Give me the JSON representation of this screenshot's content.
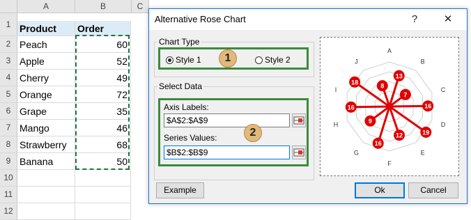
{
  "sheet": {
    "columns": [
      "A",
      "B",
      "C"
    ],
    "rows": [
      "1",
      "2",
      "3",
      "4",
      "5",
      "6",
      "7",
      "8",
      "9",
      "10",
      "11",
      "12"
    ],
    "header": {
      "product": "Product",
      "order": "Order"
    },
    "data": [
      {
        "product": "Peach",
        "order": "60"
      },
      {
        "product": "Apple",
        "order": "52"
      },
      {
        "product": "Cherry",
        "order": "49"
      },
      {
        "product": "Orange",
        "order": "72"
      },
      {
        "product": "Grape",
        "order": "35"
      },
      {
        "product": "Mango",
        "order": "46"
      },
      {
        "product": "Strawberry",
        "order": "68"
      },
      {
        "product": "Banana",
        "order": "50"
      }
    ]
  },
  "dialog": {
    "title": "Alternative Rose Chart",
    "help_label": "?",
    "close_label": "✕",
    "chart_type": {
      "legend": "Chart Type",
      "options": [
        "Style 1",
        "Style 2"
      ],
      "selected": "Style 1",
      "badge": "1"
    },
    "select_data": {
      "legend": "Select Data",
      "axis_label": "Axis Labels:",
      "axis_value": "$A$2:$A$9",
      "series_label": "Series Values:",
      "series_value": "$B$2:$B$9",
      "badge": "2"
    },
    "buttons": {
      "example": "Example",
      "ok": "Ok",
      "cancel": "Cancel"
    },
    "accent_color": "#3c8a3c",
    "preview_color": "#e00000",
    "preview": {
      "axis_letters": [
        "A",
        "B",
        "C",
        "D",
        "E",
        "F",
        "G",
        "H",
        "I",
        "J"
      ],
      "spokes": [
        {
          "label": "13",
          "value": 13
        },
        {
          "label": "7",
          "value": 7
        },
        {
          "label": "16",
          "value": 16
        },
        {
          "label": "19",
          "value": 19
        },
        {
          "label": "12",
          "value": 12
        },
        {
          "label": "16",
          "value": 16
        },
        {
          "label": "9",
          "value": 9
        },
        {
          "label": "16",
          "value": 16
        },
        {
          "label": "18",
          "value": 18
        },
        {
          "label": "8",
          "value": 8
        }
      ]
    }
  }
}
